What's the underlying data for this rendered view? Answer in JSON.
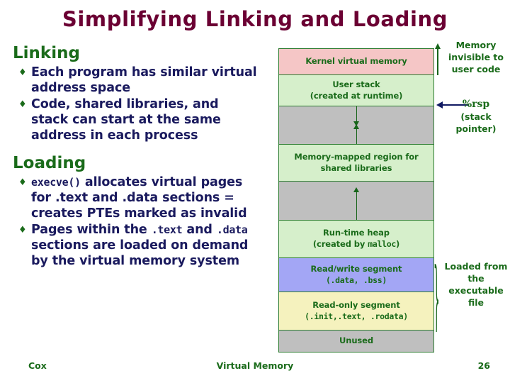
{
  "slide": {
    "title": "Simplifying Linking and Loading",
    "title_color": "#6B0033"
  },
  "left": {
    "linking": {
      "heading": "Linking",
      "bullet_marker": "♦",
      "bullets": [
        {
          "text": "Each program has similar virtual address space"
        },
        {
          "text": "Code, shared libraries, and stack can start at the same address in each process"
        }
      ]
    },
    "loading": {
      "heading": "Loading",
      "bullet_marker": "♦",
      "bullets": [
        {
          "code": "execve()",
          "text_after": "allocates virtual pages for .text and .data sections = creates PTEs marked as invalid"
        },
        {
          "text_before": "Pages within the",
          "code1": ".text",
          "text_mid": "and",
          "code2": ".data",
          "text_after": "sections are loaded on demand by the virtual memory system"
        }
      ]
    }
  },
  "diagram": {
    "name": "virtual-address-space-diagram",
    "blocks": [
      {
        "id": "kernel",
        "label": "Kernel virtual memory",
        "sublabel": "",
        "color": "#F5C6C6",
        "height": 37
      },
      {
        "id": "user-stack",
        "label": "User stack",
        "sublabel": "(created at runtime)",
        "color": "#D6EFCB",
        "height": 44
      },
      {
        "id": "gap-stack",
        "label": "",
        "sublabel": "",
        "color": "#BFBFBF",
        "height": 54,
        "arrows": "down-up"
      },
      {
        "id": "mmap",
        "label": "Memory-mapped region for",
        "sublabel": "shared libraries",
        "color": "#D6EFCB",
        "height": 52
      },
      {
        "id": "gap-heap",
        "label": "",
        "sublabel": "",
        "color": "#BFBFBF",
        "height": 55,
        "arrows": "up"
      },
      {
        "id": "heap",
        "label": "Run-time heap",
        "sublabel_pre": "(created by ",
        "sublabel_code": "malloc",
        "sublabel_post": ")",
        "color": "#D6EFCB",
        "height": 53
      },
      {
        "id": "rw-segment",
        "label": "Read/write segment",
        "sublabel_code": "(.data, .bss)",
        "color": "#A3A6F5",
        "height": 48
      },
      {
        "id": "ro-segment",
        "label": "Read-only segment",
        "sublabel_code": "(.init,.text, .rodata)",
        "color": "#F5F2BE",
        "height": 54
      },
      {
        "id": "unused",
        "label": "Unused",
        "sublabel": "",
        "color": "#BFBFBF",
        "height": 30
      }
    ]
  },
  "annotations": {
    "invisible": "Memory invisible to user code",
    "rsp_code": "%rsp",
    "rsp_sub": "(stack pointer)",
    "loaded": "Loaded from the executable file",
    "brace": "}"
  },
  "footer": {
    "author": "Cox",
    "center": "Virtual Memory",
    "page": "26"
  }
}
